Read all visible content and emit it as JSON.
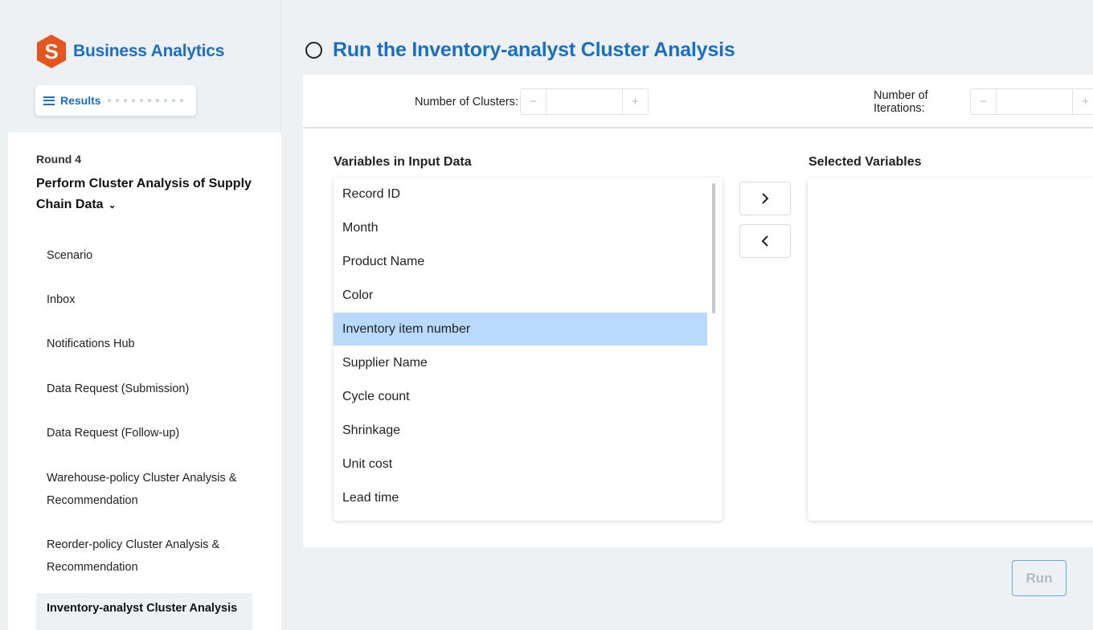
{
  "brand": {
    "title": "Business Analytics",
    "logo_letter": "S",
    "accent": "#1a6fc4",
    "logo_color": "#e8541d"
  },
  "results_pill": {
    "label": "Results"
  },
  "round": {
    "label": "Round 4",
    "title": "Perform Cluster Analysis of Supply Chain Data",
    "nav_items": [
      "Scenario",
      "Inbox",
      "Notifications Hub",
      "Data Request (Submission)",
      "Data Request (Follow-up)",
      "Warehouse-policy Cluster Analysis & Recommendation",
      "Reorder-policy Cluster Analysis & Recommendation"
    ],
    "active_item": "Inventory-analyst Cluster Analysis"
  },
  "main": {
    "title": "Run the Inventory-analyst Cluster Analysis",
    "params": {
      "clusters_label": "Number of Clusters:",
      "clusters_value": "",
      "iterations_label": "Number of Iterations:",
      "iterations_value": "",
      "minus": "−",
      "plus": "+"
    },
    "input_heading": "Variables in Input Data",
    "selected_heading": "Selected Variables",
    "variables": [
      "Record ID",
      "Month",
      "Product Name",
      "Color",
      "Inventory item number",
      "Supplier Name",
      "Cycle count",
      "Shrinkage",
      "Unit cost",
      "Lead time"
    ],
    "selected_variable": "Inventory item number",
    "selected_variables": [],
    "run_label": "Run"
  }
}
